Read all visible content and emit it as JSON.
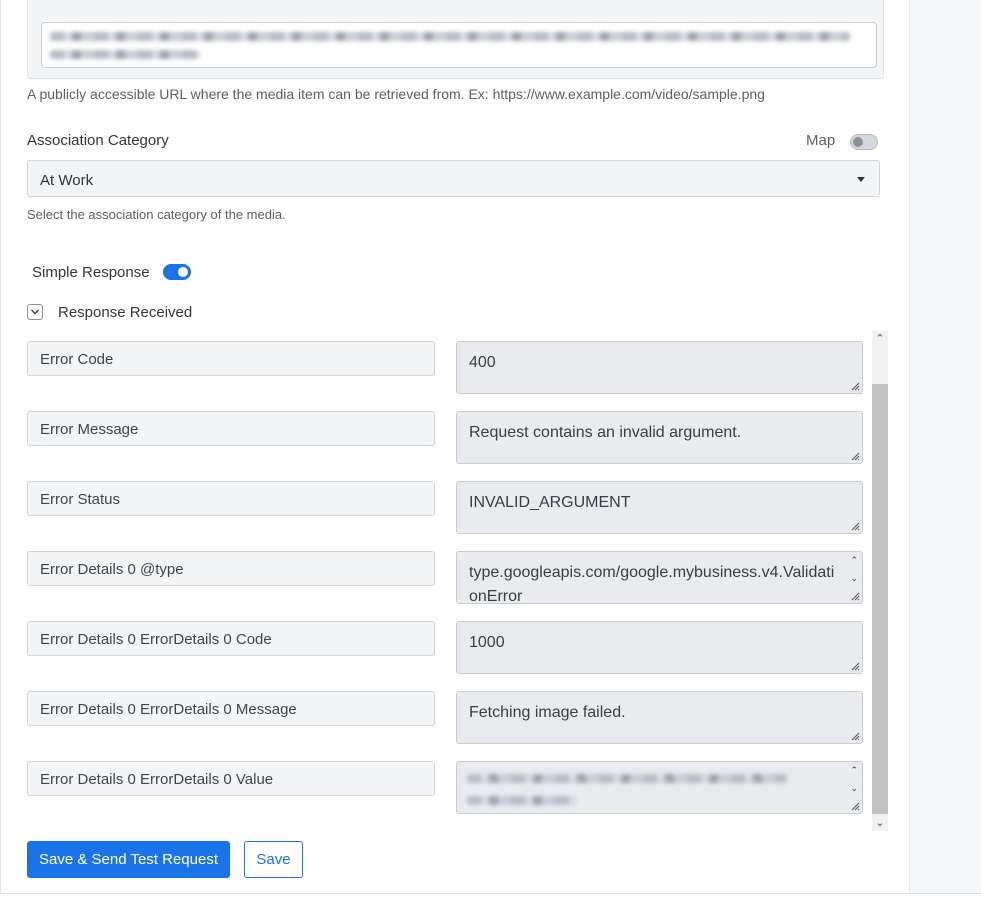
{
  "media_url": {
    "help": "A publicly accessible URL where the media item can be retrieved from. Ex: https://www.example.com/video/sample.png"
  },
  "association": {
    "label": "Association Category",
    "map_label": "Map",
    "selected": "At Work",
    "help": "Select the association category of the media."
  },
  "simple_response": {
    "label": "Simple Response"
  },
  "response_received": {
    "label": "Response Received"
  },
  "response_rows": [
    {
      "key": "Error Code",
      "value": "400"
    },
    {
      "key": "Error Message",
      "value": "Request contains an invalid argument."
    },
    {
      "key": "Error Status",
      "value": "INVALID_ARGUMENT"
    },
    {
      "key": "Error Details 0 @type",
      "value": "type.googleapis.com/google.mybusiness.v4.ValidationError"
    },
    {
      "key": "Error Details 0 ErrorDetails 0 Code",
      "value": "1000"
    },
    {
      "key": "Error Details 0 ErrorDetails 0 Message",
      "value": "Fetching image failed."
    },
    {
      "key": "Error Details 0 ErrorDetails 0 Value",
      "value": ""
    }
  ],
  "actions": {
    "save_send": "Save & Send Test Request",
    "save": "Save"
  },
  "colors": {
    "accent": "#1a73e8"
  }
}
